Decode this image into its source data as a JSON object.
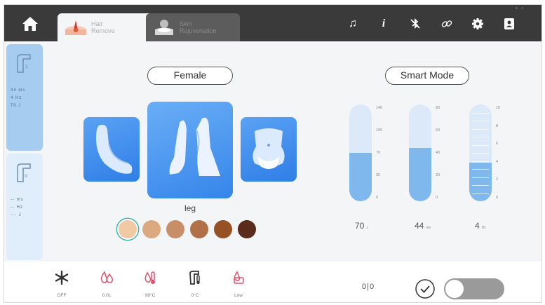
{
  "tabs": [
    {
      "label": "Hair\nRemove",
      "active": true
    },
    {
      "label": "Skin\nRejuvenation",
      "active": false
    }
  ],
  "toolbar_icons": [
    "music-icon",
    "info-icon",
    "no-bluetooth-icon",
    "link-icon",
    "gear-icon",
    "user-card-icon"
  ],
  "side": {
    "slots": [
      {
        "index": "1",
        "lines": "44 ms\n4 Hz\n70 J",
        "active": true
      },
      {
        "index": "II",
        "lines": "-- ms\n-- Hz\n--- J",
        "active": false
      }
    ]
  },
  "gender": "Female",
  "mode": "Smart Mode",
  "body_part": {
    "selected": "leg"
  },
  "skin_tones": [
    "#f1c9a5",
    "#dca87f",
    "#c88e68",
    "#b27048",
    "#965225",
    "#5b2c1c"
  ],
  "skin_tone_selected": 0,
  "gauges": [
    {
      "name": "energy",
      "ticks": [
        "140",
        "105",
        "70",
        "35",
        "0"
      ],
      "value": "70",
      "unit": "J",
      "fraction": 0.5,
      "segmented": false
    },
    {
      "name": "pulse",
      "ticks": [
        "80",
        "60",
        "40",
        "20",
        "0"
      ],
      "value": "44",
      "unit": "ms",
      "fraction": 0.55,
      "segmented": false
    },
    {
      "name": "frequency",
      "ticks": [
        "10",
        "8",
        "6",
        "4",
        "2",
        "0"
      ],
      "value": "4",
      "unit": "Hz",
      "fraction": 0.4,
      "segmented": true
    }
  ],
  "status": [
    {
      "icon": "snowflake-icon",
      "label": "OFF",
      "color": "#333333"
    },
    {
      "icon": "water-drop-icon",
      "label": "0.0L",
      "color": "#e2506d"
    },
    {
      "icon": "water-temperature-icon",
      "label": "98°C",
      "color": "#e2506d"
    },
    {
      "icon": "handpiece-temperature-icon",
      "label": "0°C",
      "color": "#333333"
    },
    {
      "icon": "water-flow-icon",
      "label": "Low",
      "color": "#e2506d"
    }
  ],
  "counter": "0|0",
  "colors": {
    "accent": "#3585ea",
    "gauge_fill": "#7fb8ec",
    "alert": "#e2506d"
  }
}
